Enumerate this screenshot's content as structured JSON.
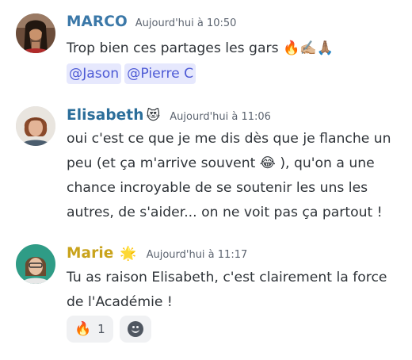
{
  "colors": {
    "marco": "#3b78a8",
    "elisabeth": "#2b6e9a",
    "marie": "#c9a31c",
    "mention_bg": "#e6e8fd",
    "mention_text": "#4e5bd5"
  },
  "messages": [
    {
      "author": "MARCO",
      "timestamp": "Aujourd'hui à 10:50",
      "text": "Trop bien ces partages les gars 🔥✍🏼🙏🏽",
      "mentions": [
        "@Jason",
        "@Pierre C"
      ]
    },
    {
      "author": "Elisabeth",
      "author_emoji": "😻",
      "timestamp": "Aujourd'hui à 11:06",
      "lines": [
        "oui c'est ce que je me dis dès que je flanche un",
        "peu (et ça m'arrive souvent 😂 ), qu'on a une",
        "chance incroyable de se soutenir les uns les",
        "autres, de s'aider... on ne voit pas ça partout !"
      ]
    },
    {
      "author": "Marie",
      "author_emoji": "🌟",
      "timestamp": "Aujourd'hui à 11:17",
      "lines": [
        "Tu as raison Elisabeth, c'est clairement la force",
        "de l'Académie !"
      ],
      "reactions": [
        {
          "emoji": "🔥",
          "count": "1"
        }
      ]
    }
  ]
}
